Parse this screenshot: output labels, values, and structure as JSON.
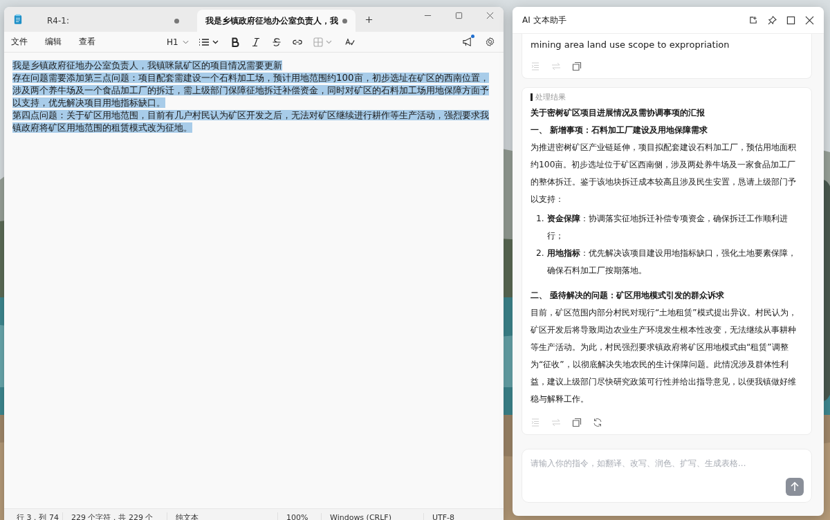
{
  "editor": {
    "tabs": [
      {
        "title": "R4-1:",
        "unsaved": true,
        "selected": false
      },
      {
        "title": "我是乡镇政府征地办公室负责人，我",
        "unsaved": true,
        "selected": true
      }
    ],
    "menu": [
      "文件",
      "编辑",
      "查看"
    ],
    "heading_select": "H1",
    "toolbar": [
      {
        "kind": "list",
        "disabled": false
      },
      {
        "kind": "bold",
        "disabled": false
      },
      {
        "kind": "italic",
        "disabled": false
      },
      {
        "kind": "strike",
        "disabled": false
      },
      {
        "kind": "link",
        "disabled": false
      },
      {
        "kind": "table",
        "disabled": true
      },
      {
        "kind": "spell",
        "disabled": false
      }
    ],
    "notification_badge": true,
    "document": {
      "selected": true,
      "paragraphs": [
        "我是乡镇政府征地办公室负责人，我镇咪鼠矿区的项目情况需要更新",
        "存在问题需要添加第三点问题：项目配套需建设一个石料加工场，预计用地范围约100亩，初步选址在矿区的西南位置，涉及两个养牛场及一个食品加工厂的拆迁，需上级部门保障征地拆迁补偿资金，同时对矿区的石料加工场用地保障方面予以支持，优先解决项目用地指标缺口。",
        "第四点问题：关于矿区用地范围，目前有几户村民认为矿区开发之后，无法对矿区继续进行耕作等生产活动，强烈要求我镇政府将矿区用地范围的租赁模式改为征地。"
      ]
    },
    "status_bar": [
      "行 3，列 74",
      "229 个字符，共 229 个",
      "纯文本",
      "100%",
      "Windows (CRLF)",
      "UTF-8"
    ]
  },
  "assistant": {
    "title": "AI 文本助手",
    "previous_card": {
      "text": "mining area land use scope to expropriation",
      "actions": [
        {
          "kind": "indent",
          "disabled": true
        },
        {
          "kind": "swap",
          "disabled": true
        },
        {
          "kind": "copy",
          "disabled": false
        }
      ]
    },
    "result_card": {
      "label": "处理结果",
      "title": "关于密树矿区项目进展情况及需协调事项的汇报",
      "blocks": [
        {
          "kind": "heading",
          "text": "一、 新增事项：石料加工厂建设及用地保障需求"
        },
        {
          "kind": "paragraph",
          "text": "为推进密树矿区产业链延伸，项目拟配套建设石料加工厂，预估用地面积约100亩。初步选址位于矿区西南侧，涉及两处养牛场及一家食品加工厂的整体拆迁。鉴于该地块拆迁成本较高且涉及民生安置，恳请上级部门予以支持："
        },
        {
          "kind": "list",
          "items": [
            {
              "marker": "1.",
              "text": "**资金保障**：协调落实征地拆迁补偿专项资金，确保拆迁工作顺利进行；"
            },
            {
              "marker": "2.",
              "text": "**用地指标**：优先解决该项目建设用地指标缺口，强化土地要素保障，确保石料加工厂按期落地。"
            }
          ]
        },
        {
          "kind": "heading",
          "text": "二、 亟待解决的问题：矿区用地模式引发的群众诉求"
        },
        {
          "kind": "paragraph",
          "text": "目前，矿区范围内部分村民对现行“土地租赁”模式提出异议。村民认为，矿区开发后将导致周边农业生产环境发生根本性改变，无法继续从事耕种等生产活动。为此，村民强烈要求镇政府将矿区用地模式由“租赁”调整为“征收”，以彻底解决失地农民的生计保障问题。此情况涉及群体性利益，建议上级部门尽快研究政策可行性并给出指导意见，以便我镇做好维稳与解释工作。"
        }
      ],
      "actions": [
        {
          "kind": "indent",
          "disabled": true
        },
        {
          "kind": "swap",
          "disabled": true
        },
        {
          "kind": "copy",
          "disabled": false
        },
        {
          "kind": "refresh",
          "disabled": false
        }
      ]
    },
    "input": {
      "placeholder": "请输入你的指令，如翻译、改写、润色、扩写、生成表格..."
    }
  }
}
